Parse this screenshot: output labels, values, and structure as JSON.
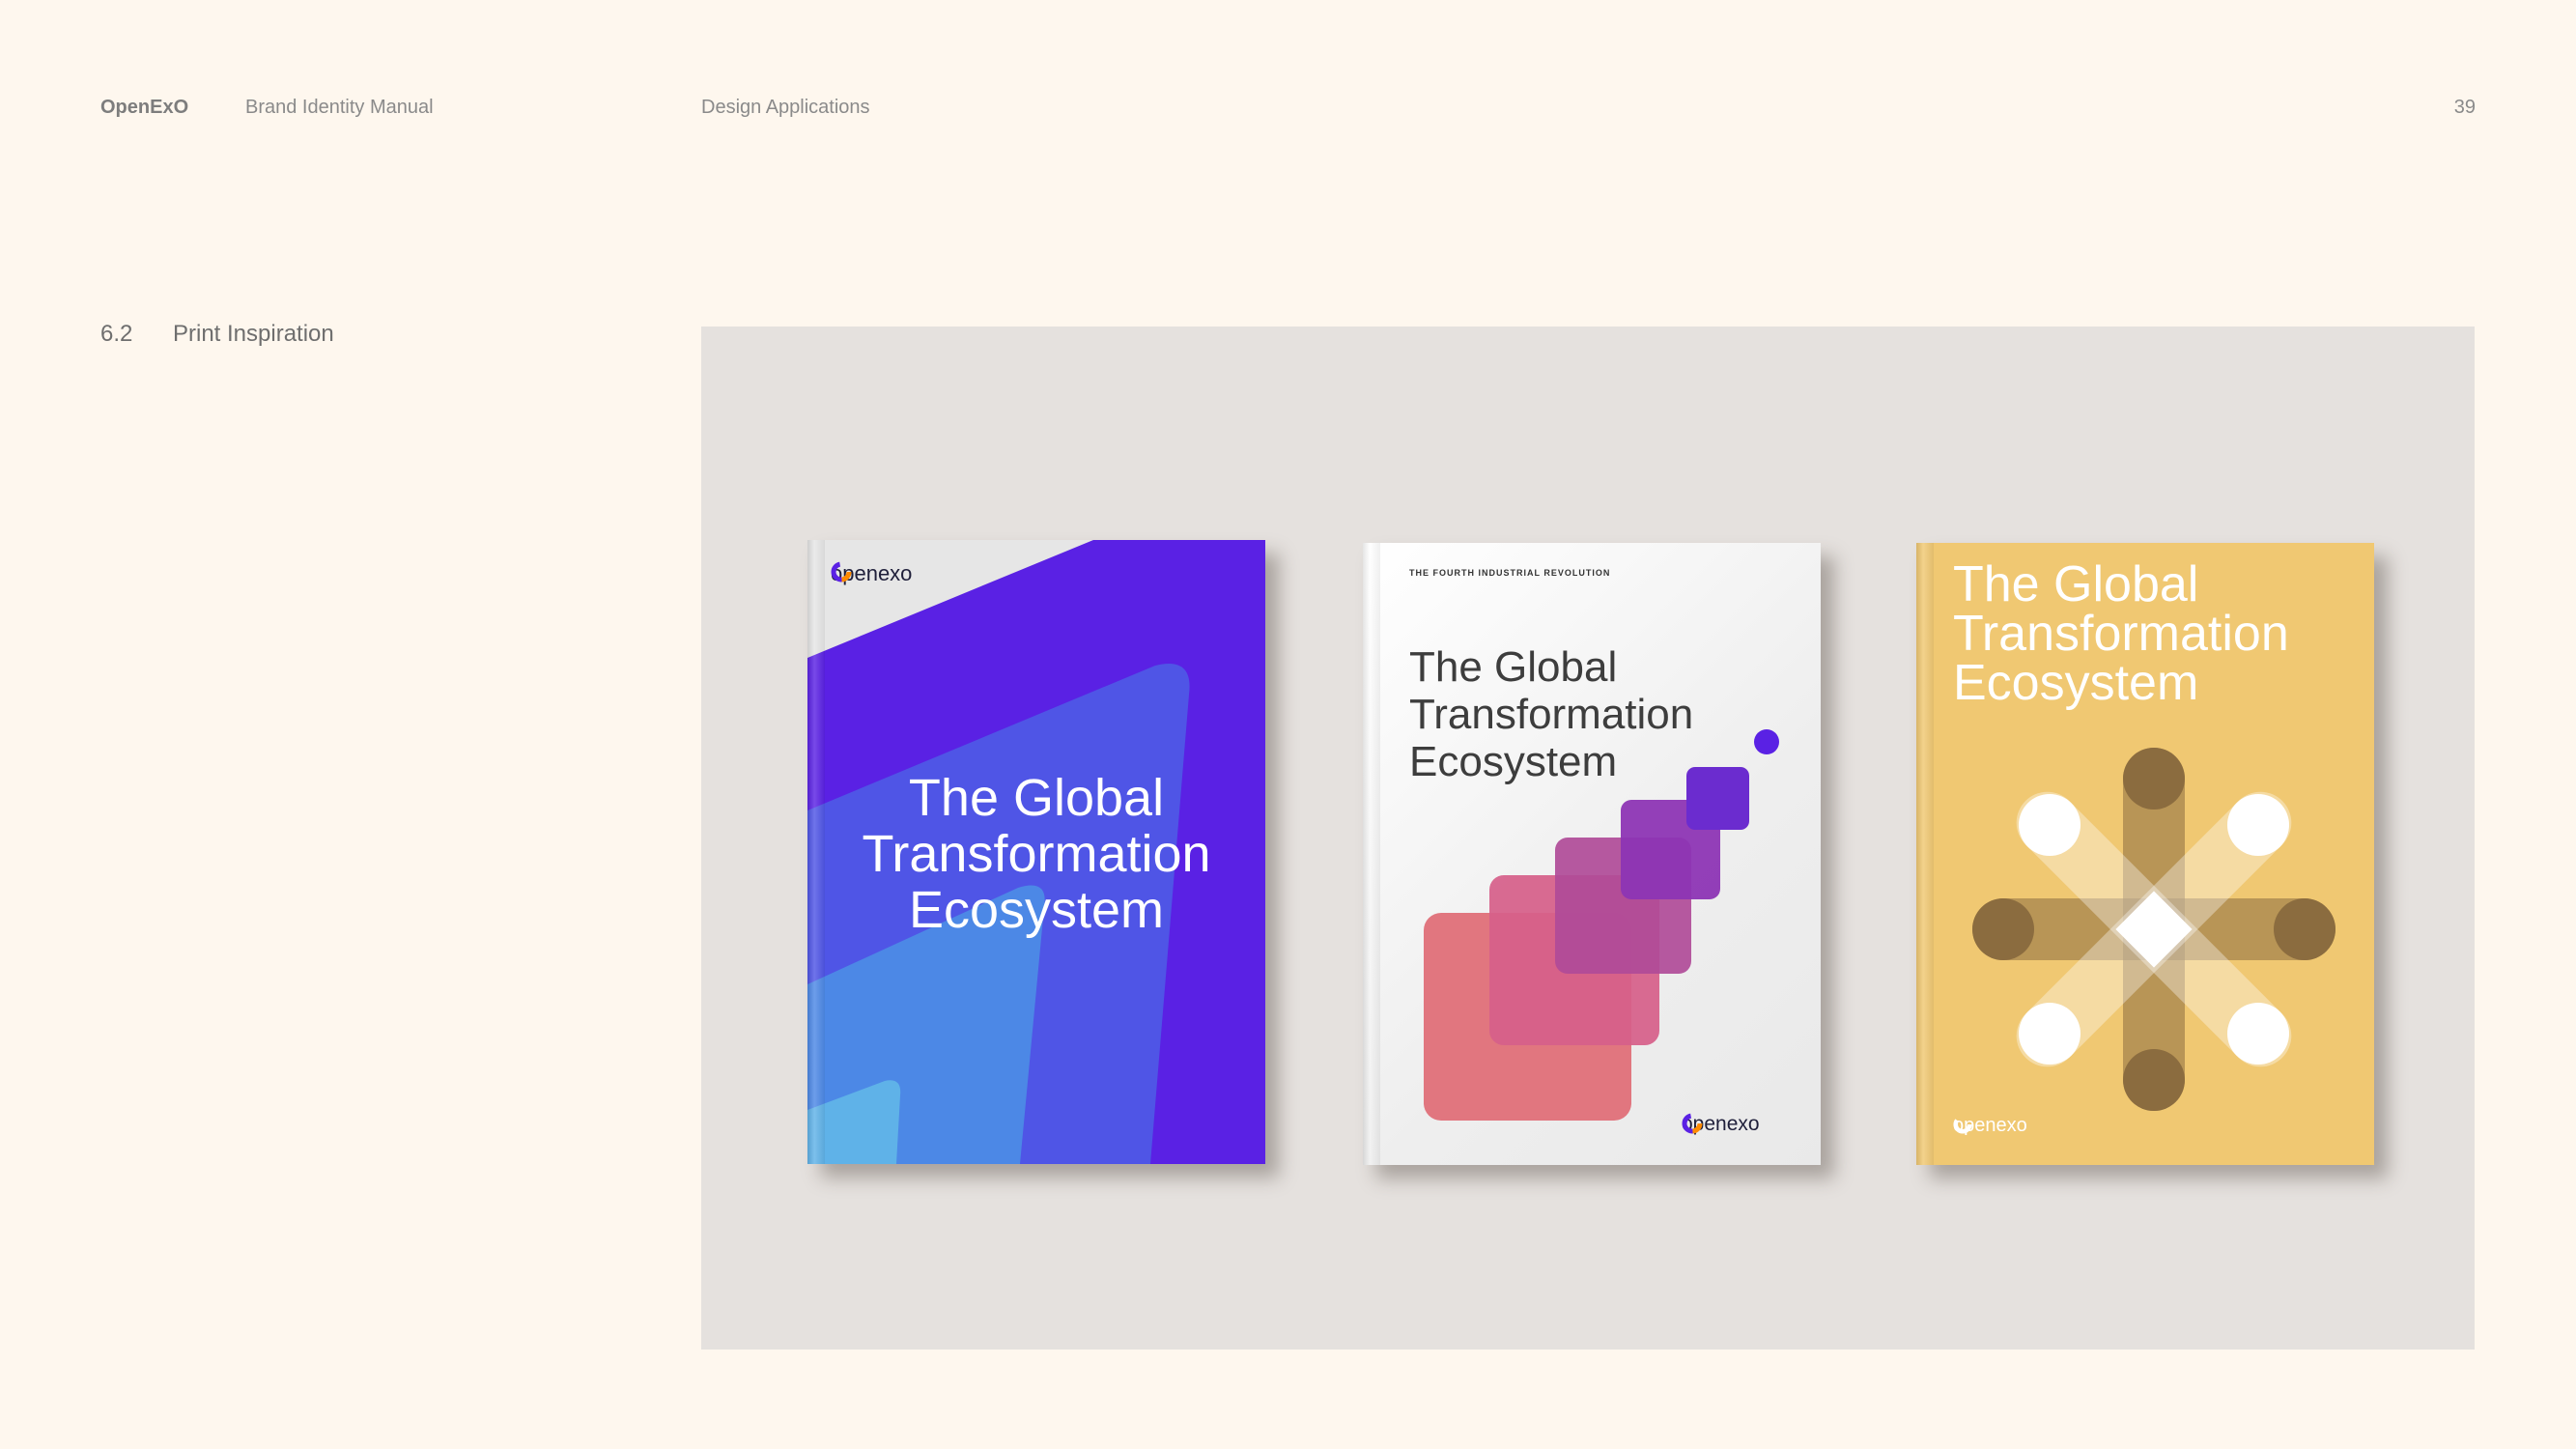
{
  "header": {
    "brand": "OpenExO",
    "document": "Brand Identity Manual",
    "chapter": "Design Applications",
    "page_number": "39"
  },
  "section": {
    "number": "6.2",
    "title": "Print Inspiration"
  },
  "books": [
    {
      "logo": "openexo",
      "title_lines": [
        "The Global",
        "Transformation",
        "Ecosystem"
      ],
      "colors": {
        "cover": "#5a21e4",
        "accent_light": "#4b8fe6"
      }
    },
    {
      "kicker": "THE FOURTH INDUSTRIAL REVOLUTION",
      "logo": "openexo",
      "title_lines": [
        "The Global",
        "Transformation",
        "Ecosystem"
      ],
      "colors": {
        "cover": "#f2f2f2",
        "squares": [
          "#e0707a",
          "#d6608a",
          "#b04b98",
          "#8d35b4",
          "#6b2ccf"
        ]
      }
    },
    {
      "logo": "openexo",
      "title_lines": [
        "The Global",
        "Transformation",
        "Ecosystem"
      ],
      "colors": {
        "cover": "#f0c872",
        "bars": "#8b6c3f"
      }
    }
  ]
}
